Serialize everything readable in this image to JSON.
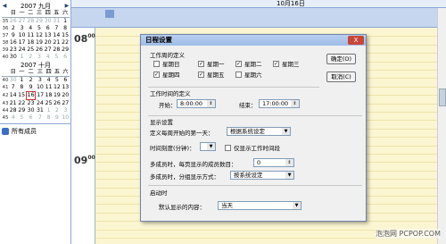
{
  "calendar": {
    "sep": {
      "title": "2007 九月",
      "weekdays": [
        "日",
        "一",
        "二",
        "三",
        "四",
        "五",
        "六"
      ],
      "rows": [
        {
          "wk": "35",
          "days": [
            "26",
            "27",
            "28",
            "29",
            "30",
            "31",
            "1"
          ]
        },
        {
          "wk": "36",
          "days": [
            "2",
            "3",
            "4",
            "5",
            "6",
            "7",
            "8"
          ]
        },
        {
          "wk": "37",
          "days": [
            "9",
            "10",
            "11",
            "12",
            "13",
            "14",
            "15"
          ]
        },
        {
          "wk": "38",
          "days": [
            "16",
            "17",
            "18",
            "19",
            "20",
            "21",
            "22"
          ]
        },
        {
          "wk": "39",
          "days": [
            "23",
            "24",
            "25",
            "26",
            "27",
            "28",
            "29"
          ]
        },
        {
          "wk": "40",
          "days": [
            "30",
            "1",
            "2",
            "3",
            "4",
            "5",
            "6"
          ]
        }
      ]
    },
    "oct": {
      "title": "2007 十月",
      "weekdays": [
        "日",
        "一",
        "二",
        "三",
        "四",
        "五",
        "六"
      ],
      "rows": [
        {
          "wk": "40",
          "days": [
            "30",
            "1",
            "2",
            "3",
            "4",
            "5",
            "6"
          ]
        },
        {
          "wk": "41",
          "days": [
            "7",
            "8",
            "9",
            "10",
            "11",
            "12",
            "13"
          ]
        },
        {
          "wk": "42",
          "days": [
            "14",
            "15",
            "16",
            "17",
            "18",
            "19",
            "20"
          ]
        },
        {
          "wk": "43",
          "days": [
            "21",
            "22",
            "23",
            "24",
            "25",
            "26",
            "27"
          ]
        },
        {
          "wk": "44",
          "days": [
            "28",
            "29",
            "30",
            "31",
            "1",
            "2",
            "3"
          ]
        },
        {
          "wk": "45",
          "days": [
            "4",
            "5",
            "6",
            "7",
            "8",
            "9",
            "10"
          ]
        }
      ]
    }
  },
  "contacts": {
    "all_members": "所有成员"
  },
  "schedule": {
    "date_header": "10月16日",
    "hour1": "08",
    "hour2": "09",
    "suffix": "00"
  },
  "dialog": {
    "title": "日程设置",
    "close_label": "X",
    "workweek": {
      "label": "工作周的定义",
      "days": [
        {
          "name": "星期日",
          "checked": false
        },
        {
          "name": "星期一",
          "checked": true
        },
        {
          "name": "星期二",
          "checked": true
        },
        {
          "name": "星期三",
          "checked": true
        },
        {
          "name": "星期四",
          "checked": true
        },
        {
          "name": "星期五",
          "checked": true
        },
        {
          "name": "星期六",
          "checked": false
        }
      ]
    },
    "worktime": {
      "label": "工作时间的定义",
      "start_label": "开始：",
      "start_value": "8:00:00",
      "end_label": "结束：",
      "end_value": "17:00:00"
    },
    "display": {
      "label": "显示设置",
      "first_day_label": "定义每周开始的第一天：",
      "first_day_value": "根据系统设定",
      "time_scale_label": "时间刻度(分钟)：",
      "time_scale_value": "",
      "only_work_label": "仅显示工作时间段",
      "max_members_label": "多成员时，每页显示的成员数目：",
      "max_members_value": "0",
      "group_mode_label": "多成员时，分组显示方式：",
      "group_mode_value": "按系统设定"
    },
    "startup": {
      "label": "启动时",
      "default_label": "默认显示的内容：",
      "default_value": "当天"
    },
    "ok_label": "确定(O)",
    "cancel_label": "取消(C)"
  },
  "watermark": "泡泡网 PCPOP.COM"
}
